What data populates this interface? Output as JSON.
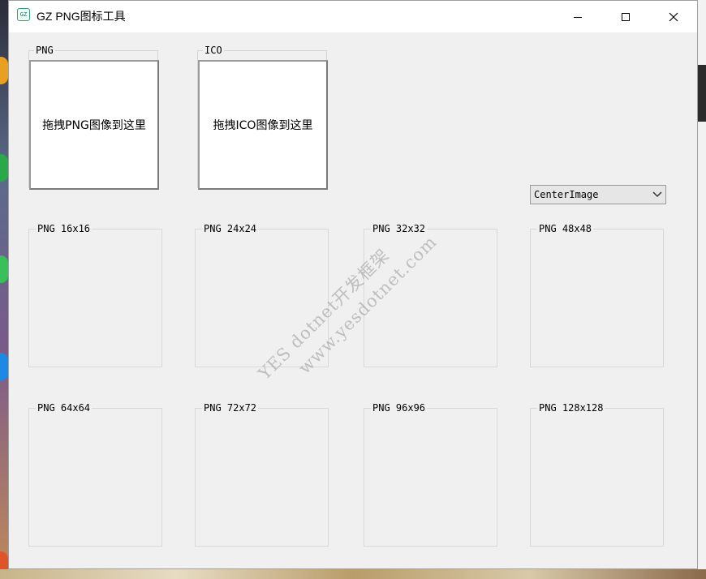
{
  "window": {
    "title": "GZ PNG图标工具",
    "icon_label": "GZ"
  },
  "inputs": {
    "png": {
      "label": "PNG",
      "hint": "拖拽PNG图像到这里"
    },
    "ico": {
      "label": "ICO",
      "hint": "拖拽ICO图像到这里"
    }
  },
  "size_mode": {
    "selected": "CenterImage"
  },
  "previews": [
    {
      "label": "PNG 16x16"
    },
    {
      "label": "PNG 24x24"
    },
    {
      "label": "PNG 32x32"
    },
    {
      "label": "PNG 48x48"
    },
    {
      "label": "PNG 64x64"
    },
    {
      "label": "PNG 72x72"
    },
    {
      "label": "PNG 96x96"
    },
    {
      "label": "PNG 128x128"
    }
  ],
  "watermark": {
    "line1": "YES dotnet开发框架",
    "line2": "www.yesdotnet.com"
  }
}
